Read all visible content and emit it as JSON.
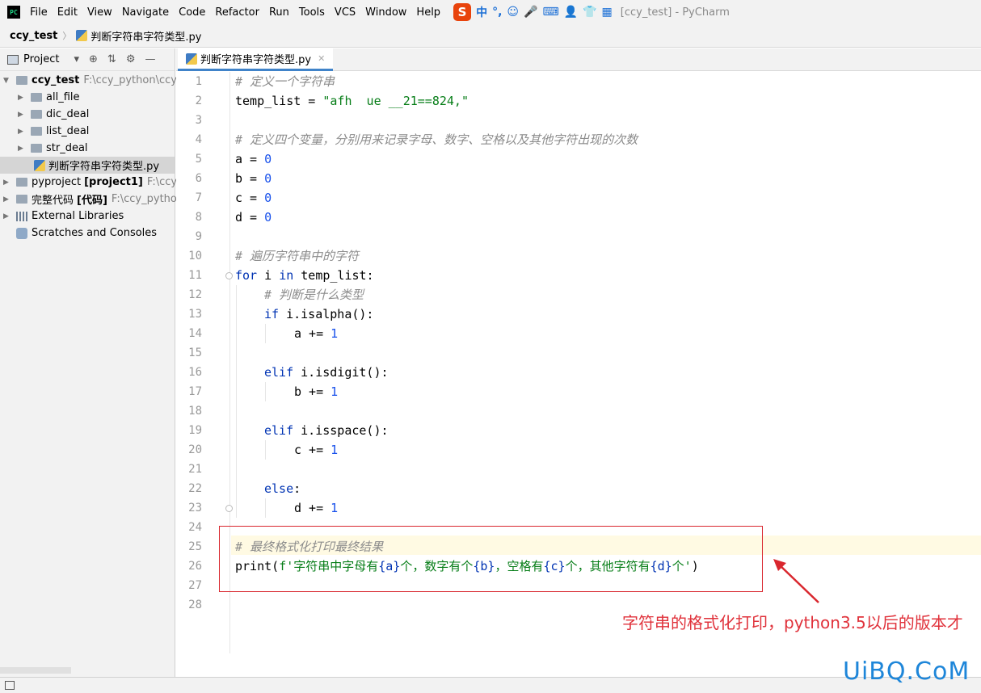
{
  "app": {
    "logo_text": "PC",
    "window_title": "[ccy_test] - PyCharm"
  },
  "menu": [
    "File",
    "Edit",
    "View",
    "Navigate",
    "Code",
    "Refactor",
    "Run",
    "Tools",
    "VCS",
    "Window",
    "Help"
  ],
  "ime": {
    "logo": "S",
    "glyphs": [
      "中",
      "°,",
      "☺",
      "🎤",
      "⌨",
      "👤",
      "👕",
      "▦"
    ]
  },
  "breadcrumb": {
    "project": "ccy_test",
    "separator": "〉",
    "file": "判断字符串字符类型.py"
  },
  "project_panel": {
    "title": "Project",
    "tree": [
      {
        "label": "ccy_test",
        "path": "F:\\ccy_python\\ccy_t",
        "bold": true
      },
      {
        "label": "all_file"
      },
      {
        "label": "dic_deal"
      },
      {
        "label": "list_deal"
      },
      {
        "label": "str_deal"
      },
      {
        "label": "判断字符串字符类型.py"
      },
      {
        "label": "pyproject",
        "extra": "[project1]",
        "path": "F:\\ccy_p"
      },
      {
        "label": "完整代码",
        "extra": "[代码]",
        "path": "F:\\ccy_python"
      },
      {
        "label": "External Libraries"
      },
      {
        "label": "Scratches and Consoles"
      }
    ]
  },
  "editor": {
    "tab_label": "判断字符串字符类型.py",
    "line_numbers": [
      "1",
      "2",
      "3",
      "4",
      "5",
      "6",
      "7",
      "8",
      "9",
      "10",
      "11",
      "12",
      "13",
      "14",
      "15",
      "16",
      "17",
      "18",
      "19",
      "20",
      "21",
      "22",
      "23",
      "24",
      "25",
      "26",
      "27",
      "28"
    ],
    "code": {
      "l1": "# 定义一个字符串",
      "l2_var": "temp_list = ",
      "l2_str": "\"afh  ue __21==824,\"",
      "l4": "# 定义四个变量，分别用来记录字母、数字、空格以及其他字符出现的次数",
      "l5_var": "a = ",
      "l5_num": "0",
      "l6_var": "b = ",
      "l6_num": "0",
      "l7_var": "c = ",
      "l7_num": "0",
      "l8_var": "d = ",
      "l8_num": "0",
      "l10": "# 遍历字符串中的字符",
      "l11_kw1": "for",
      "l11_a": " i ",
      "l11_kw2": "in",
      "l11_b": " temp_list:",
      "l12": "# 判断是什么类型",
      "l13_kw": "if",
      "l13_rest": " i.isalpha():",
      "l14_var": "a += ",
      "l14_num": "1",
      "l16_kw": "elif",
      "l16_rest": " i.isdigit():",
      "l17_var": "b += ",
      "l17_num": "1",
      "l19_kw": "elif",
      "l19_rest": " i.isspace():",
      "l20_var": "c += ",
      "l20_num": "1",
      "l22_kw": "else",
      "l22_rest": ":",
      "l23_var": "d += ",
      "l23_num": "1",
      "l25": "# 最终格式化打印最终结果",
      "l26_fn": "print(",
      "l26_fstr": "f'字符串中字母有",
      "l26_a": "{a}",
      "l26_s1": "个，数字有个",
      "l26_b": "{b}",
      "l26_s2": "，空格有",
      "l26_c": "{c}",
      "l26_s3": "个，其他字符有",
      "l26_d": "{d}",
      "l26_s4": "个'",
      "l26_end": ")"
    }
  },
  "annotation": {
    "text": "字符串的格式化打印，python3.5以后的版本才",
    "color": "#e0323b"
  },
  "watermark": "UiBQ.CoM",
  "colors": {
    "keyword": "#0033b3",
    "string": "#067d17",
    "number": "#1750eb",
    "comment": "#8c8c8c",
    "tab_underline": "#4083c9"
  }
}
